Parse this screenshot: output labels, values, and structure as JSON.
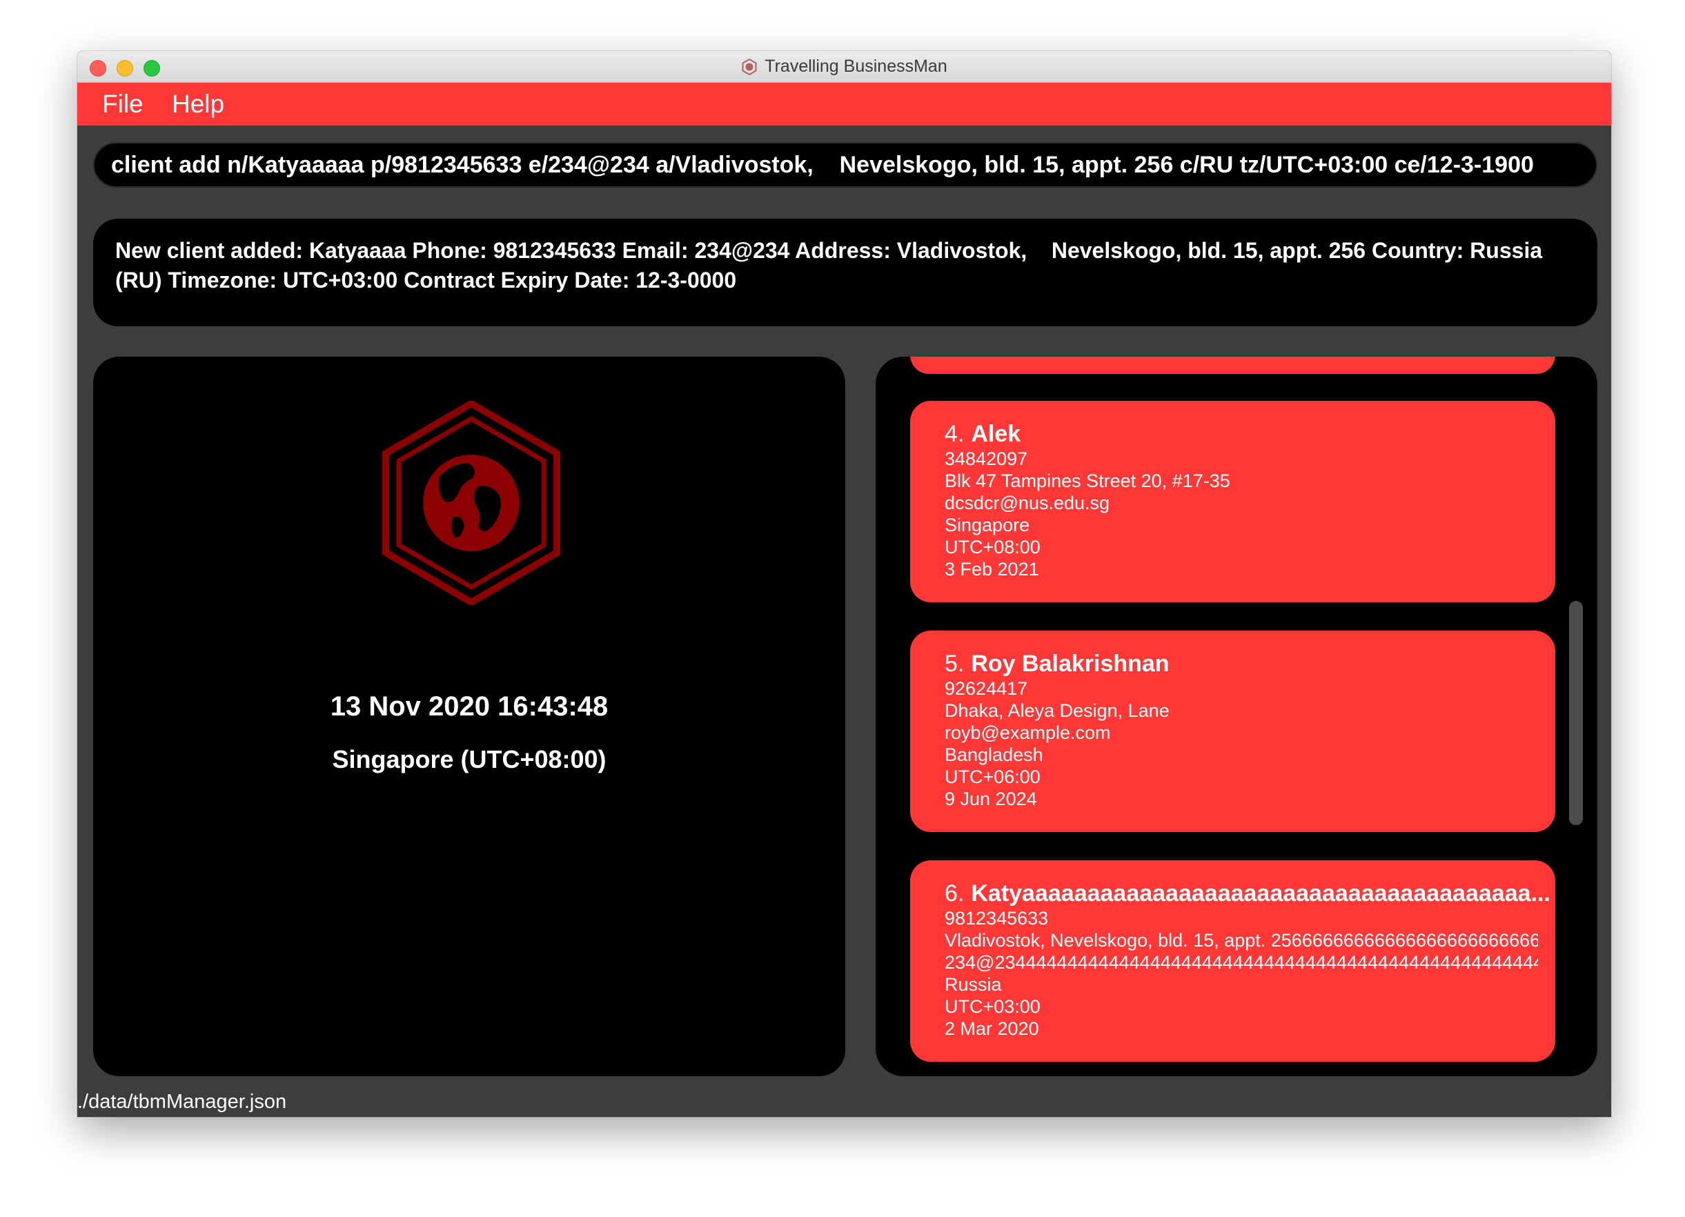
{
  "window": {
    "title": "Travelling BusinessMan"
  },
  "menu": {
    "file": "File",
    "help": "Help"
  },
  "command": {
    "value": "client add n/Katyaaaaa p/9812345633 e/234@234 a/Vladivostok,    Nevelskogo, bld. 15, appt. 256 c/RU tz/UTC+03:00 ce/12-3-1900"
  },
  "result": {
    "text": "New client added: Katyaaaa Phone: 9812345633 Email: 234@234 Address: Vladivostok,    Nevelskogo, bld. 15, appt. 256 Country: Russia\n(RU) Timezone: UTC+03:00 Contract Expiry Date: 12-3-0000"
  },
  "clock": {
    "time": "13 Nov 2020 16:43:48",
    "zone": "Singapore (UTC+08:00)"
  },
  "clients": [
    {
      "index": "4.",
      "name": "Alek",
      "phone": "34842097",
      "address": "Blk 47 Tampines Street 20, #17-35",
      "email": "dcsdcr@nus.edu.sg",
      "country": "Singapore",
      "timezone": "UTC+08:00",
      "expiry": "3 Feb 2021"
    },
    {
      "index": "5.",
      "name": "Roy Balakrishnan",
      "phone": "92624417",
      "address": "Dhaka, Aleya Design, Lane",
      "email": "royb@example.com",
      "country": "Bangladesh",
      "timezone": "UTC+06:00",
      "expiry": "9 Jun 2024"
    },
    {
      "index": "6.",
      "name": "Katyaaaaaaaaaaaaaaaaaaaaaaaaaaaaaaaaaaaaaaa...",
      "phone": "9812345633",
      "address": "Vladivostok,    Nevelskogo, bld. 15, appt. 25666666666666666666666666...",
      "email": "234@2344444444444444444444444444444444444444444444444444444...",
      "country": "Russia",
      "timezone": "UTC+03:00",
      "expiry": "2 Mar 2020"
    }
  ],
  "status": {
    "path": "./data/tbmManager.json"
  },
  "colors": {
    "accent": "#ff3737",
    "panel": "#000000",
    "background": "#3d3d3d",
    "logo": "#8b0000"
  }
}
